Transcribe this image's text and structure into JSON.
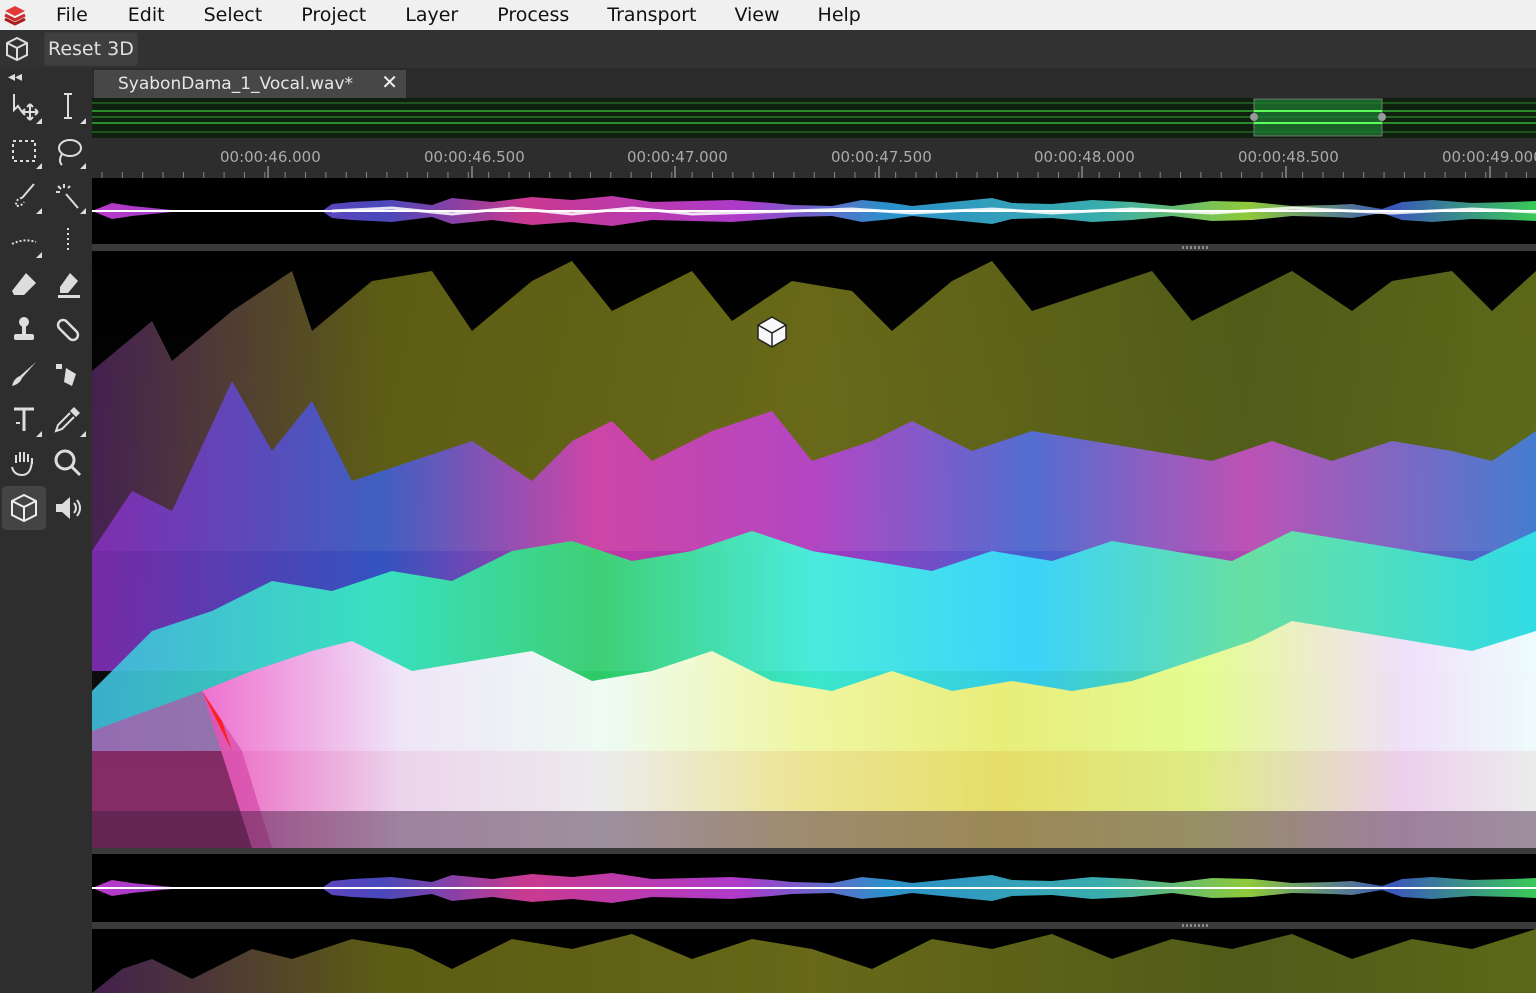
{
  "menubar": {
    "logo_icon": "layers-logo-icon",
    "items": [
      "File",
      "Edit",
      "Select",
      "Project",
      "Layer",
      "Process",
      "Transport",
      "View",
      "Help"
    ]
  },
  "toolbar": {
    "cube_icon": "cube-icon",
    "reset_label": "Reset 3D"
  },
  "toolpanel": {
    "collapse_glyph": "◂◂",
    "tools": [
      "move-icon",
      "text-cursor-icon",
      "rect-select-icon",
      "lasso-icon",
      "brush-select-icon",
      "magic-wand-icon",
      "dotted-line-icon",
      "vertical-dots-icon",
      "eraser-icon",
      "smart-eraser-icon",
      "clone-stamp-icon",
      "bandage-icon",
      "brush-icon",
      "spray-icon",
      "text-tool-icon",
      "eyedropper-icon",
      "hand-icon",
      "zoom-icon",
      "3d-cube-icon",
      "speaker-icon"
    ],
    "active_tool": "3d-cube-icon"
  },
  "tab": {
    "title": "SyabonDama_1_Vocal.wav*",
    "close_glyph": "✕"
  },
  "overview": {
    "accent_color": "#32d232",
    "viewport_fraction_start": 0.805,
    "viewport_fraction_end": 0.895
  },
  "ruler": {
    "labels": [
      "00:00:46.000",
      "00:00:46.500",
      "00:00:47.000",
      "00:00:47.500",
      "00:00:48.000",
      "00:00:48.500",
      "00:00:49.000"
    ]
  },
  "colors": {
    "accent_green": "#2ee02e",
    "spectro_magenta": "#e040e0",
    "spectro_cyan": "#30e0e0",
    "spectro_yellow": "#f0f060",
    "spectro_olive": "#8a8a1a"
  }
}
